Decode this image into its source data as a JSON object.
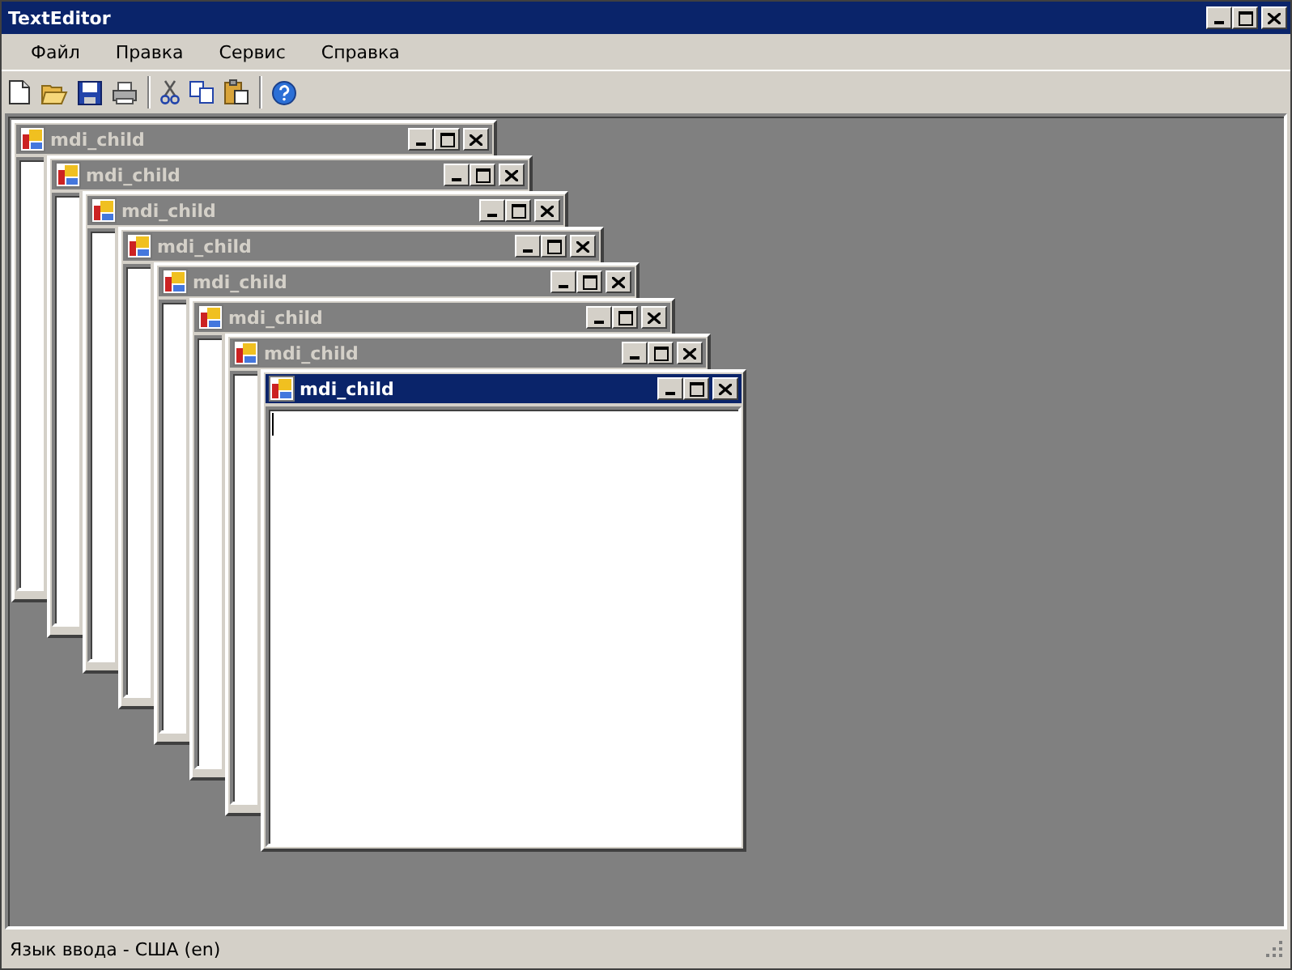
{
  "window": {
    "title": "TextEditor"
  },
  "menu": [
    "Файл",
    "Правка",
    "Сервис",
    "Справка"
  ],
  "mdi_children": [
    {
      "title": "mdi_child",
      "selected": false
    },
    {
      "title": "mdi_child",
      "selected": false
    },
    {
      "title": "mdi_child",
      "selected": false
    },
    {
      "title": "mdi_child",
      "selected": false
    },
    {
      "title": "mdi_child",
      "selected": false
    },
    {
      "title": "mdi_child",
      "selected": false
    },
    {
      "title": "mdi_child",
      "selected": false
    },
    {
      "title": "mdi_child",
      "selected": true
    }
  ],
  "status_bar": {
    "text": "Язык ввода - США (en)"
  }
}
